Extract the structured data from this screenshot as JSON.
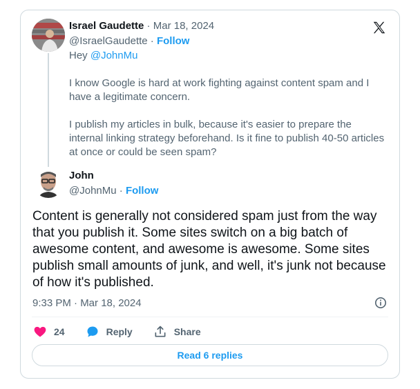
{
  "parent": {
    "name": "Israel Gaudette",
    "separator": " · ",
    "date": "Mar 18, 2024",
    "handle": "@IsraelGaudette",
    "follow_label": "Follow",
    "greeting": "Hey ",
    "mention": "@JohnMu",
    "paragraph1": "I know Google is hard at work fighting against content spam and I have a legitimate concern.",
    "paragraph2": "I publish my articles in bulk, because it's easier to prepare the internal linking strategy beforehand. Is it fine to publish 40-50 articles at once or could be seen spam?"
  },
  "reply": {
    "name": "John",
    "handle": "@JohnMu",
    "follow_label": "Follow",
    "text": "Content is generally not considered spam just from the way that you publish it. Some sites switch on a big batch of awesome content, and awesome is awesome. Some sites publish small amounts of junk, and well, it's junk not because of how it's published.",
    "timestamp": "9:33 PM · Mar 18, 2024"
  },
  "actions": {
    "like_count": "24",
    "reply_label": "Reply",
    "share_label": "Share"
  },
  "read_replies_label": "Read 6 replies",
  "colors": {
    "accent": "#1d9bf0",
    "like": "#f91880",
    "text": "#0f1419",
    "muted": "#536471",
    "border": "#cfd9de"
  },
  "icons": [
    "x-logo-icon",
    "info-icon",
    "heart-icon",
    "reply-bubble-icon",
    "share-icon"
  ]
}
